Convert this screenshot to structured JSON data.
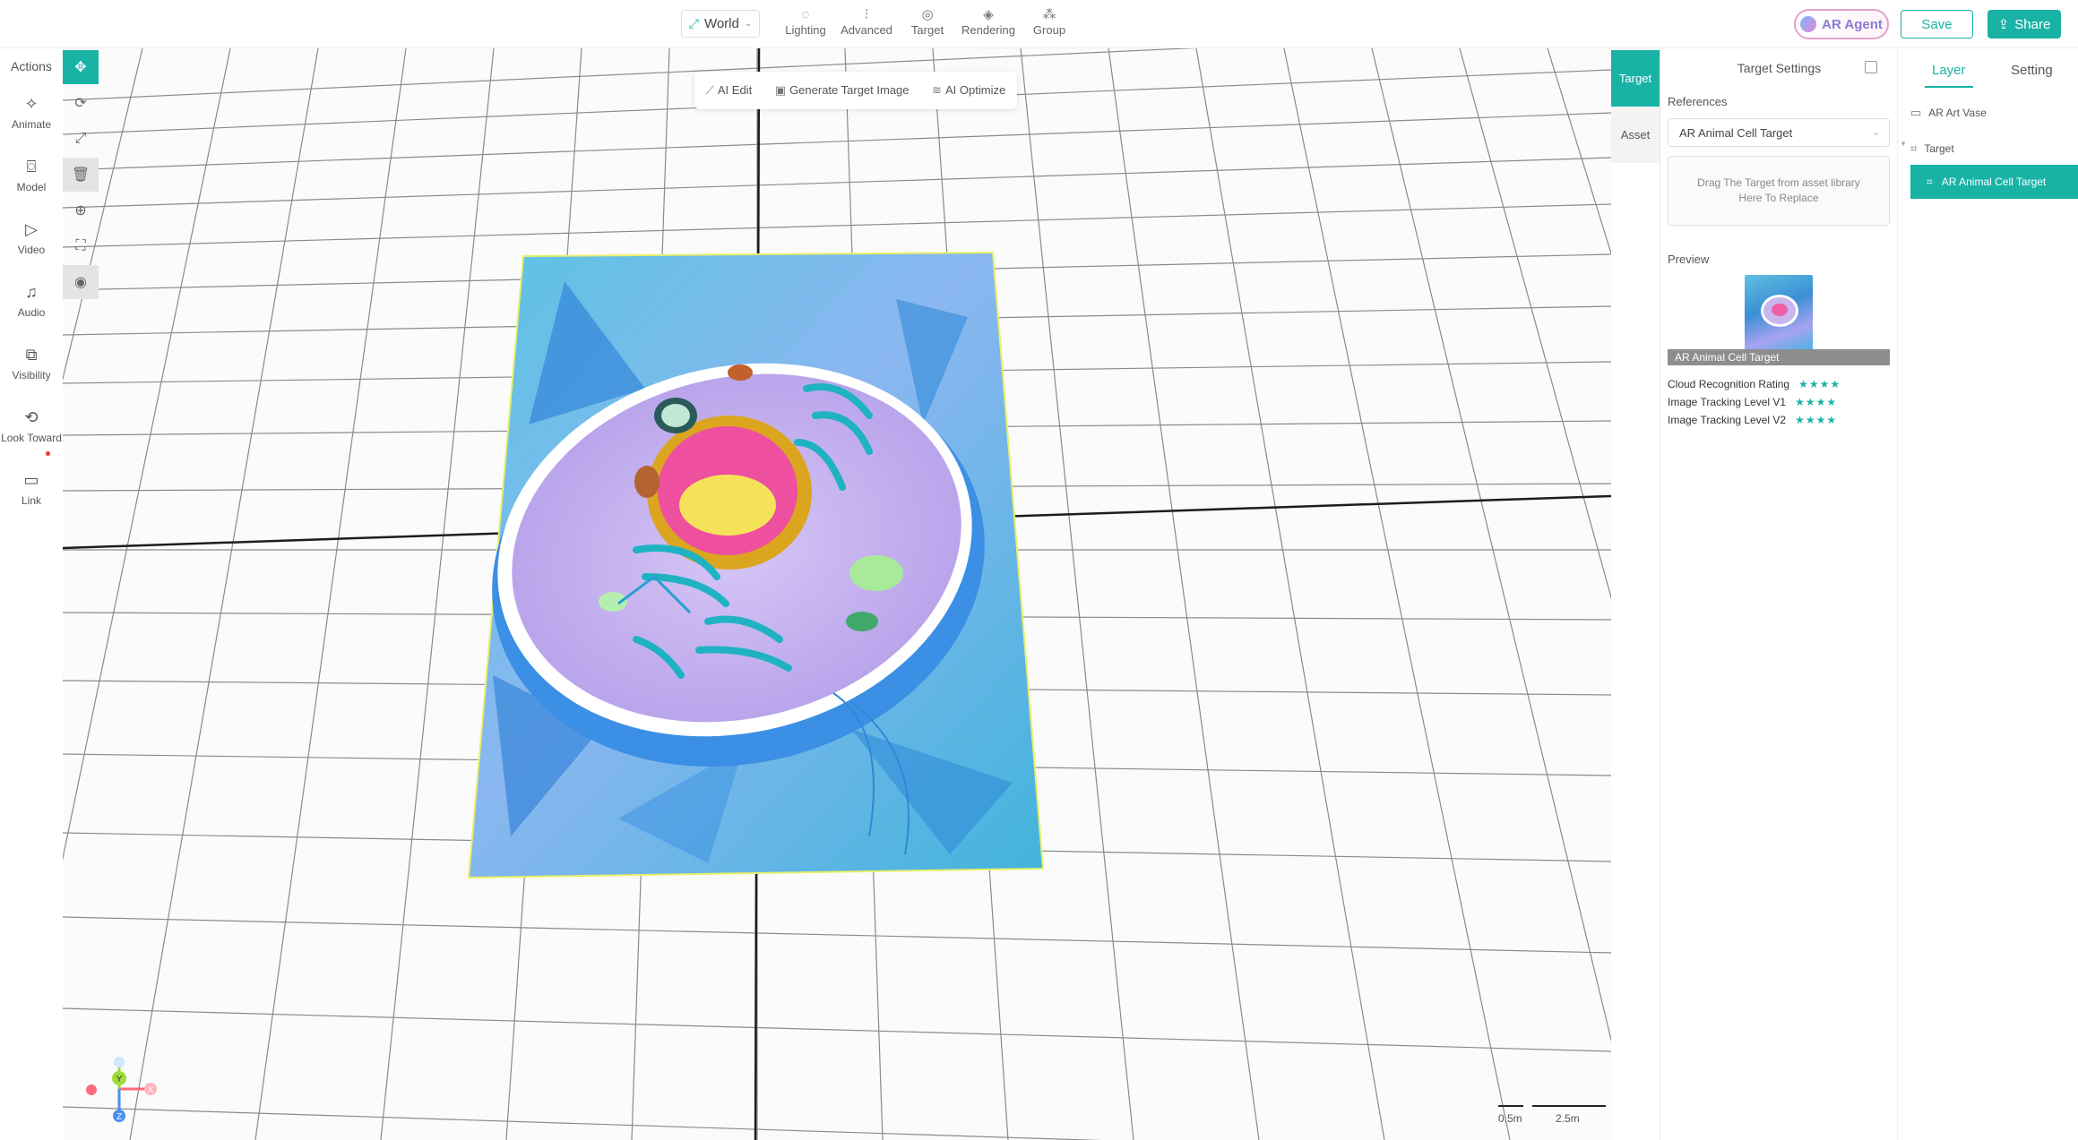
{
  "topbar": {
    "space_label": "World",
    "tools": [
      {
        "label": "Lighting",
        "icon": "bulb-icon"
      },
      {
        "label": "Advanced",
        "icon": "sliders-icon"
      },
      {
        "label": "Target",
        "icon": "target-icon"
      },
      {
        "label": "Rendering",
        "icon": "rendering-icon"
      },
      {
        "label": "Group",
        "icon": "group-icon"
      }
    ],
    "ar_agent_label": "AR Agent",
    "save_label": "Save",
    "share_label": "Share"
  },
  "actions": {
    "title": "Actions",
    "items": [
      {
        "label": "Animate",
        "icon": "sparkle-icon"
      },
      {
        "label": "Model",
        "icon": "model-icon"
      },
      {
        "label": "Video",
        "icon": "play-icon"
      },
      {
        "label": "Audio",
        "icon": "music-icon"
      },
      {
        "label": "Visibility",
        "icon": "visibility-icon"
      },
      {
        "label": "Look Toward",
        "icon": "look-toward-icon"
      },
      {
        "label": "Link",
        "icon": "link-icon"
      }
    ]
  },
  "viewport_tools": [
    "move-icon",
    "rotate-icon",
    "scale-icon",
    "trash-icon",
    "focus-icon",
    "fit-icon",
    "eye-icon"
  ],
  "float_toolbar": {
    "ai_edit": "AI Edit",
    "generate": "Generate Target Image",
    "optimize": "AI Optimize"
  },
  "scale_bar": {
    "small": "0.5m",
    "large": "2.5m"
  },
  "gizmo": {
    "x": "X",
    "y": "Y",
    "z": "Z"
  },
  "side_tabs": {
    "target": "Target",
    "asset": "Asset"
  },
  "target_settings": {
    "title": "Target Settings",
    "references_label": "References",
    "reference_value": "AR Animal Cell Target",
    "dropzone_text": "Drag The Target from asset library Here To Replace",
    "preview_label": "Preview",
    "preview_caption": "AR Animal Cell Target",
    "ratings": [
      {
        "label": "Cloud Recognition Rating",
        "stars": 4
      },
      {
        "label": "Image Tracking Level V1",
        "stars": 4
      },
      {
        "label": "Image Tracking Level V2",
        "stars": 4
      }
    ]
  },
  "layer_panel": {
    "tab_layer": "Layer",
    "tab_setting": "Setting",
    "items": [
      {
        "label": "AR Art Vase",
        "icon": "scene-icon"
      },
      {
        "label": "Target",
        "icon": "target-frame-icon"
      }
    ],
    "selected": "AR Animal Cell Target"
  },
  "colors": {
    "accent": "#19b3a6",
    "danger": "#ee3333"
  }
}
